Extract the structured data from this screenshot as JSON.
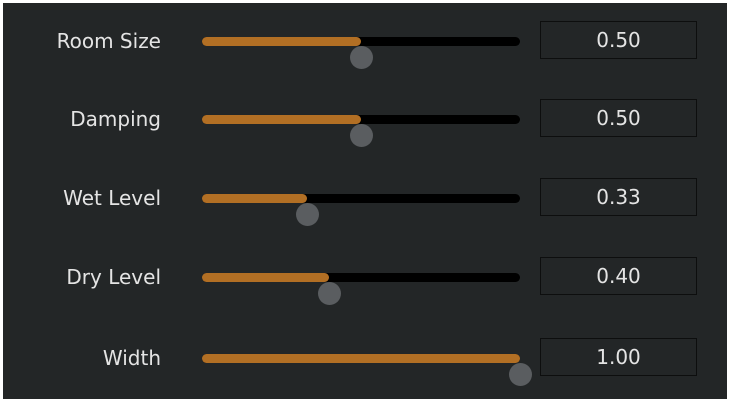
{
  "colors": {
    "background": "#232627",
    "track": "#000000",
    "fill": "#b26f24",
    "thumb": "#5a5d60",
    "text": "#e4e4e4",
    "value_box_border": "#0d0e0e"
  },
  "params": [
    {
      "label": "Room Size",
      "value_text": "0.50",
      "level": 0.5
    },
    {
      "label": "Damping",
      "value_text": "0.50",
      "level": 0.5
    },
    {
      "label": "Wet Level",
      "value_text": "0.33",
      "level": 0.33
    },
    {
      "label": "Dry Level",
      "value_text": "0.40",
      "level": 0.4
    },
    {
      "label": "Width",
      "value_text": "1.00",
      "level": 1.0
    }
  ]
}
